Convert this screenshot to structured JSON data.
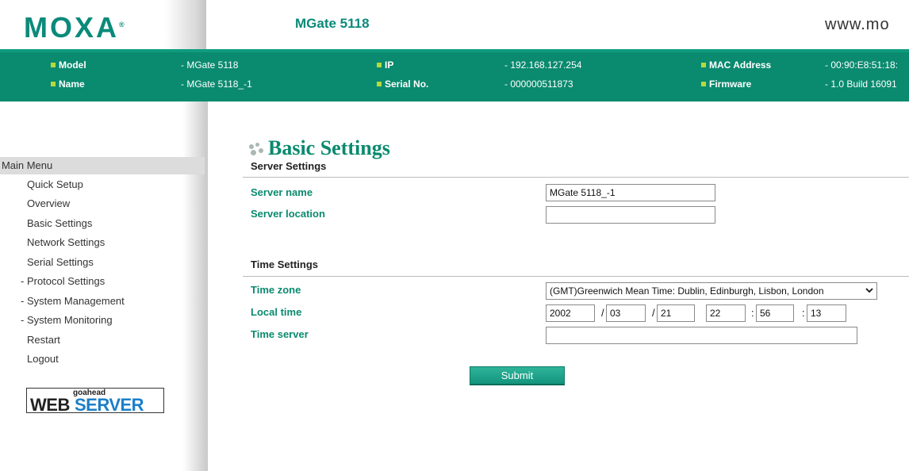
{
  "header": {
    "logo": "MOXA",
    "logo_mark": "®",
    "product": "MGate 5118",
    "url": "www.mo"
  },
  "info": {
    "model_label": "Model",
    "model_value": "- MGate 5118",
    "name_label": "Name",
    "name_value": "- MGate 5118_-1",
    "ip_label": "IP",
    "ip_value": "- 192.168.127.254",
    "serial_label": "Serial No.",
    "serial_value": "- 000000511873",
    "mac_label": "MAC Address",
    "mac_value": "- 00:90:E8:51:18:",
    "firmware_label": "Firmware",
    "firmware_value": "- 1.0 Build 16091"
  },
  "sidebar": {
    "main_menu": "- Main Menu",
    "items": [
      "Quick Setup",
      "Overview",
      "Basic Settings",
      "Network Settings",
      "Serial Settings",
      "- Protocol Settings",
      "- System Management",
      "- System Monitoring",
      "Restart",
      "Logout"
    ],
    "badge_small": "goahead",
    "badge_web": "WEB",
    "badge_server": "SERVER"
  },
  "content": {
    "heading": "Basic Settings",
    "server_section": "Server Settings",
    "server_name_label": "Server name",
    "server_name_value": "MGate 5118_-1",
    "server_location_label": "Server location",
    "server_location_value": "",
    "time_section": "Time Settings",
    "time_zone_label": "Time zone",
    "time_zone_value": "(GMT)Greenwich Mean Time: Dublin, Edinburgh, Lisbon, London",
    "local_time_label": "Local time",
    "year": "2002",
    "month": "03",
    "day": "21",
    "hour": "22",
    "minute": "56",
    "second": "13",
    "date_sep": "/",
    "time_sep": ":",
    "time_server_label": "Time server",
    "time_server_value": "",
    "submit": "Submit"
  },
  "colors": {
    "brand_green": "#0a8a6f",
    "bullet_yellow": "#b7d93b",
    "link_blue": "#1b7fc8"
  }
}
